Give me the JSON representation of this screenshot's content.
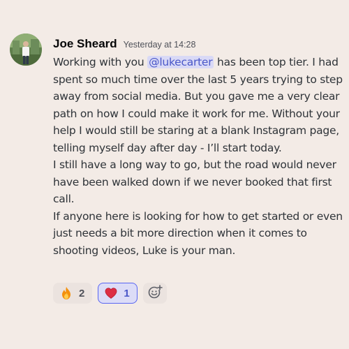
{
  "message": {
    "author": "Joe Sheard",
    "timestamp": "Yesterday at 14:28",
    "paragraphs": [
      {
        "before": "Working with you ",
        "mention": "@lukecarter",
        "after": " has been top tier. I had spent so much time over the last 5 years trying to step away from social media. But you gave me a very clear path on how I could make it work for me. Without your help I would still be staring at a blank Instagram page, telling myself day after day - I’ll start today."
      },
      {
        "text": "I still have a long way to go, but the road would never have been walked down if we never booked that first call."
      },
      {
        "text": "If anyone here is looking for how to get started or even just needs a bit more direction when it comes to shooting videos, Luke is your man."
      }
    ]
  },
  "reactions": [
    {
      "emoji": "fire-icon",
      "count": "2",
      "active": false
    },
    {
      "emoji": "heart-icon",
      "count": "1",
      "active": true
    }
  ],
  "add_reaction_icon": "smile-plus-icon",
  "colors": {
    "background": "#f3ebe6",
    "mention_bg": "#d9d9f6",
    "mention_text": "#4a57c8",
    "active_border": "#5865f2"
  }
}
